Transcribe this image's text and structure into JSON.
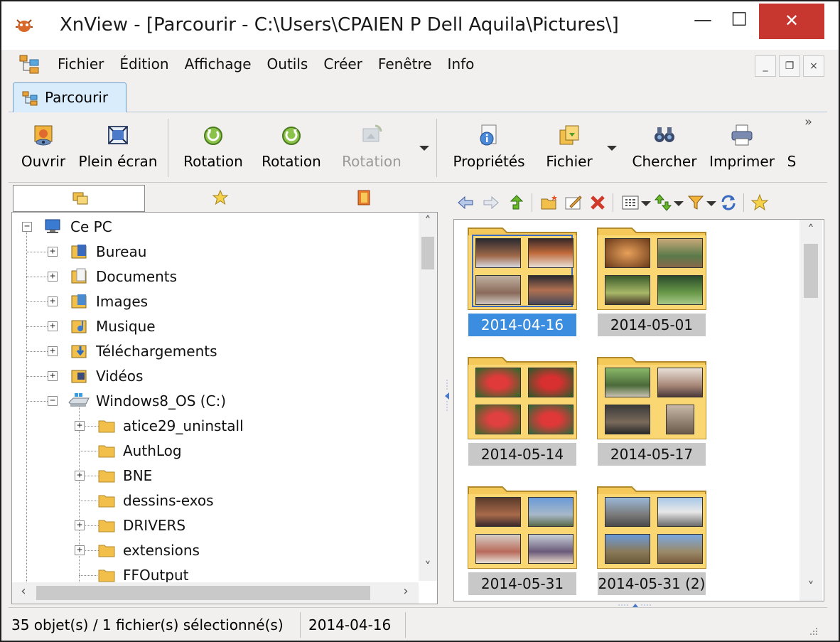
{
  "window": {
    "title": "XnView - [Parcourir - C:\\Users\\CPAIEN P Dell Aquila\\Pictures\\]",
    "min_glyph": "—",
    "max_glyph": "☐",
    "close_glyph": "✕"
  },
  "menubar": {
    "items": [
      "Fichier",
      "Édition",
      "Affichage",
      "Outils",
      "Créer",
      "Fenêtre",
      "Info"
    ],
    "mdi_min": "_",
    "mdi_restore": "❐",
    "mdi_close": "×"
  },
  "tabs": [
    {
      "label": "Parcourir"
    }
  ],
  "toolbar": {
    "buttons": [
      {
        "label": "Ouvrir",
        "icon": "open-image-icon"
      },
      {
        "label": "Plein écran",
        "icon": "fullscreen-icon"
      },
      {
        "label": "Rotation",
        "icon": "rotate-left-icon"
      },
      {
        "label": "Rotation",
        "icon": "rotate-right-icon"
      },
      {
        "label": "Rotation",
        "icon": "rotate-lossless-icon"
      },
      {
        "label": "Propriétés",
        "icon": "properties-icon"
      },
      {
        "label": "Fichier",
        "icon": "file-icon"
      },
      {
        "label": "Chercher",
        "icon": "binoculars-icon"
      },
      {
        "label": "Imprimer",
        "icon": "printer-icon"
      },
      {
        "label": "S",
        "icon": ""
      }
    ],
    "overflow": "»"
  },
  "tree": {
    "items": [
      {
        "label": "Ce PC",
        "toggle": "−"
      },
      {
        "label": "Bureau",
        "toggle": "+"
      },
      {
        "label": "Documents",
        "toggle": "+"
      },
      {
        "label": "Images",
        "toggle": "+"
      },
      {
        "label": "Musique",
        "toggle": "+"
      },
      {
        "label": "Téléchargements",
        "toggle": "+"
      },
      {
        "label": "Vidéos",
        "toggle": "+"
      },
      {
        "label": "Windows8_OS (C:)",
        "toggle": "−"
      },
      {
        "label": "atice29_uninstall",
        "toggle": "+"
      },
      {
        "label": "AuthLog",
        "toggle": ""
      },
      {
        "label": "BNE",
        "toggle": "+"
      },
      {
        "label": "dessins-exos",
        "toggle": ""
      },
      {
        "label": "DRIVERS",
        "toggle": "+"
      },
      {
        "label": "extensions",
        "toggle": "+"
      },
      {
        "label": "FFOutput",
        "toggle": ""
      }
    ]
  },
  "thumbnails": [
    {
      "label": "2014-04-16",
      "selected": true
    },
    {
      "label": "2014-05-01",
      "selected": false
    },
    {
      "label": "2014-05-14",
      "selected": false
    },
    {
      "label": "2014-05-17",
      "selected": false
    },
    {
      "label": "2014-05-31",
      "selected": false
    },
    {
      "label": "2014-05-31 (2)",
      "selected": false
    }
  ],
  "status": {
    "count": "35 objet(s) / 1 fichier(s) sélectionné(s)",
    "selected_name": "2014-04-16"
  },
  "colors": {
    "selection": "#3b8de0",
    "folder": "#f5c85a",
    "close": "#c7372f"
  }
}
